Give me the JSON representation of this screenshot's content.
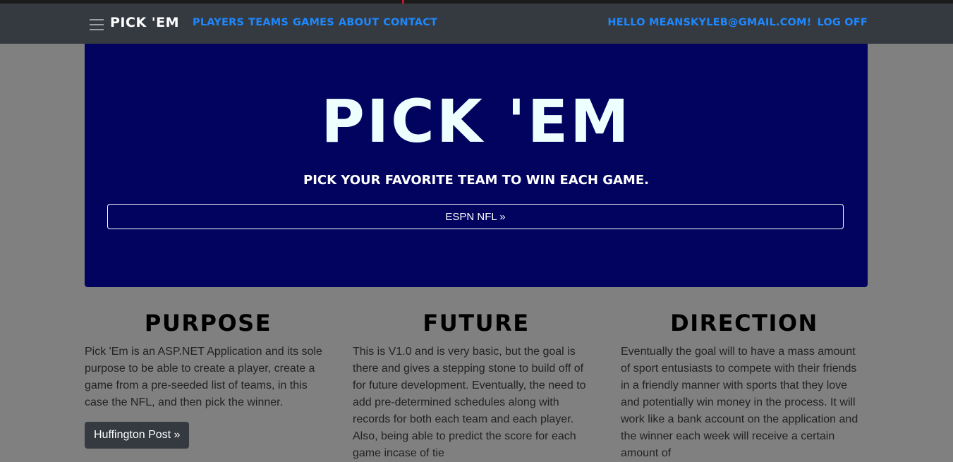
{
  "navbar": {
    "brand": "Pick 'Em",
    "links": [
      "Players",
      "Teams",
      "Games",
      "About",
      "Contact"
    ],
    "greeting": "Hello meanskyleb@gmail.com!",
    "logoff": "Log off"
  },
  "hero": {
    "title": "Pick 'Em",
    "subtitle": "Pick your favorite team to win each game.",
    "button": "ESPN NFL »"
  },
  "columns": [
    {
      "heading": "Purpose",
      "text": "Pick 'Em is an ASP.NET Application and its sole purpose to be able to create a player, create a game from a pre-seeded list of teams, in this case the NFL, and then pick the winner."
    },
    {
      "heading": "Future",
      "text": "This is V1.0 and is very basic, but the goal is there and gives a stepping stone to build off of for future development. Eventually, the need to add pre-determined schedules along with records for both each team and each player. Also, being able to predict the score for each game incase of tie"
    },
    {
      "heading": "Direction",
      "text": "Eventually the goal will to have a mass amount of sport entusiasts to compete with their friends in a friendly manner with sports that they love and potentially win money in the process. It will work like a bank account on the application and the winner each week will receive a certain amount of"
    }
  ],
  "purpose_button": "Huffington Post »",
  "colors": {
    "navbar_bg": "#353a40",
    "nav_link": "#1e88ff",
    "hero_bg": "#02035f",
    "page_bg": "#808080"
  }
}
